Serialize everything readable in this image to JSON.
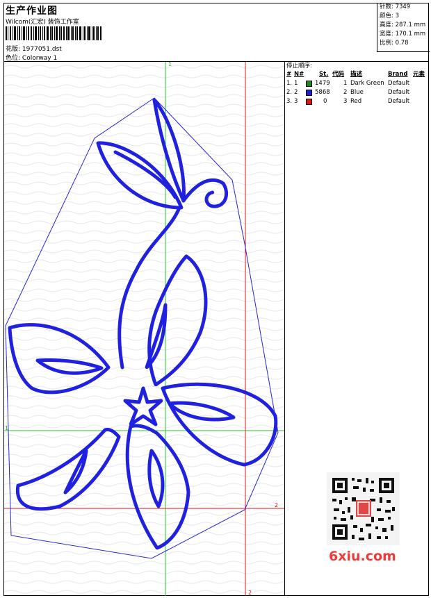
{
  "header": {
    "title": "生产作业图",
    "subtitle": "Wilcom(汇宏) 装饰工作室",
    "design_label": "花版:",
    "design_value": "1977051.dst",
    "colorway_label": "色位:",
    "colorway_value": "Colorway 1"
  },
  "stats": {
    "stitches_label": "针数:",
    "stitches_value": "7349",
    "colors_label": "颜色:",
    "colors_value": "3",
    "height_label": "高度:",
    "height_value": "287.1 mm",
    "width_label": "宽度:",
    "width_value": "170.1 mm",
    "scale_label": "比例:",
    "scale_value": "0.78"
  },
  "stop_sequence": {
    "title": "停止顺序:",
    "columns": [
      "#",
      "N#",
      "St.",
      "代码",
      "描述",
      "Brand",
      "元素"
    ],
    "rows": [
      {
        "num": "1.",
        "n": "1",
        "st": "1479",
        "code": "1",
        "desc": "Dark Green",
        "brand": "Default",
        "color": "#1a8a1a"
      },
      {
        "num": "2.",
        "n": "2",
        "st": "5868",
        "code": "2",
        "desc": "Blue",
        "brand": "Default",
        "color": "#1f1fd6"
      },
      {
        "num": "3.",
        "n": "3",
        "st": "0",
        "code": "3",
        "desc": "Red",
        "brand": "Default",
        "color": "#e01515"
      }
    ]
  },
  "canvas": {
    "stitch_color": "#2020e0",
    "axis_labels": {
      "green_v": "1",
      "green_h": "1",
      "red_v": "2",
      "red_h": "2"
    }
  },
  "watermark": "6xiu.com"
}
